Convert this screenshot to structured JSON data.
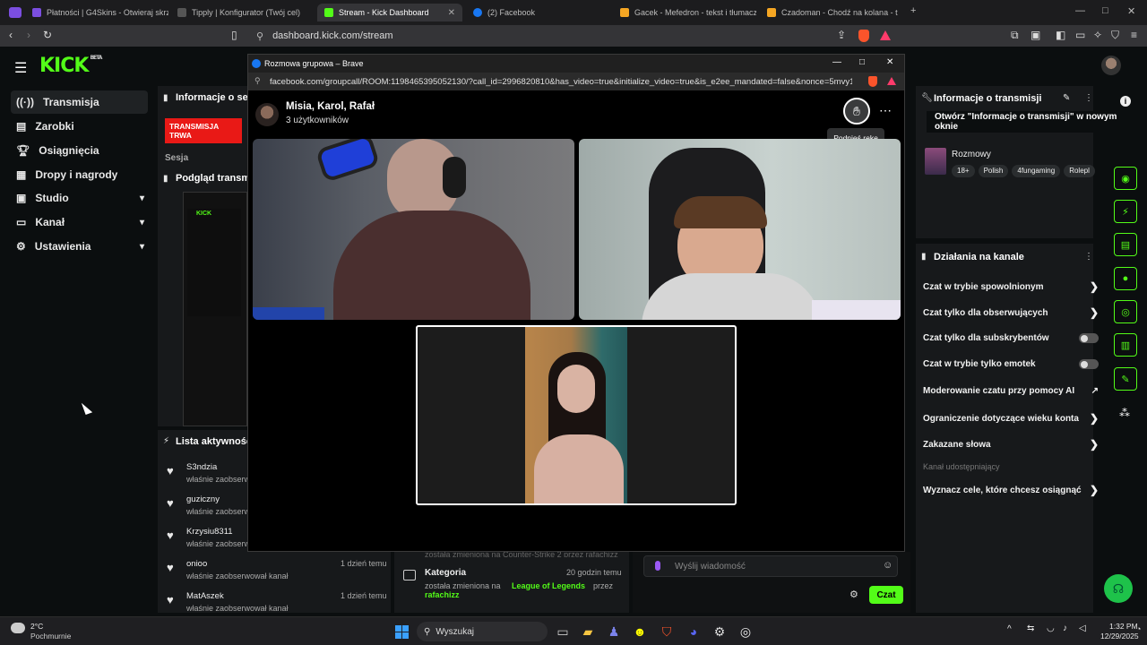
{
  "browser": {
    "tabs": [
      {
        "label": "Płatności | G4Skins - Otwieraj skrzyn",
        "color": "#7b4ee0"
      },
      {
        "label": "Tipply | Konfigurator (Twój cel)",
        "color": "#444"
      },
      {
        "label": "Stream - Kick Dashboard",
        "color": "#53fc18"
      },
      {
        "label": "(2) Facebook",
        "color": "#1877f2"
      },
      {
        "label": "Gacek - Mefedron - tekst i tłumaczen",
        "color": "#f5a623"
      },
      {
        "label": "Czadoman - Chodź na kolana - tekst",
        "color": "#f5a623"
      }
    ],
    "url": "dashboard.kick.com/stream"
  },
  "kick": {
    "logo": "KICK",
    "logo_badge": "BETA",
    "nav": [
      {
        "label": "Transmisja",
        "icon": "broadcast-icon"
      },
      {
        "label": "Zarobki",
        "icon": "money-icon"
      },
      {
        "label": "Osiągnięcia",
        "icon": "trophy-icon"
      },
      {
        "label": "Dropy i nagrody",
        "icon": "gift-icon"
      },
      {
        "label": "Studio",
        "icon": "studio-icon"
      },
      {
        "label": "Kanał",
        "icon": "channel-icon"
      },
      {
        "label": "Ustawienia",
        "icon": "gear-icon"
      }
    ],
    "session_info": {
      "title": "Informacje o sesji",
      "status": "TRANSMISJA TRWA",
      "session_label": "Sesja"
    },
    "preview": {
      "title": "Podgląd transmisji"
    },
    "activity": {
      "title": "Lista aktywności",
      "items": [
        {
          "user": "S3ndzia",
          "text": "właśnie zaobserwował kanał",
          "time": ""
        },
        {
          "user": "guziczny",
          "text": "właśnie zaobserwował kanał",
          "time": ""
        },
        {
          "user": "Krzysiu8311",
          "text": "właśnie zaobserwował kanał",
          "time": ""
        },
        {
          "user": "onioo",
          "text": "właśnie zaobserwował kanał",
          "time": "1 dzień temu"
        },
        {
          "user": "MatAszek",
          "text": "właśnie zaobserwował kanał",
          "time": "1 dzień temu"
        }
      ]
    },
    "history": {
      "partial": "została zmieniona na Counter-Strike 2 przez rafachizz",
      "title": "Kategoria",
      "time": "20 godzin temu",
      "text_prefix": "została zmieniona na",
      "game": "League of Legends",
      "by": "przez",
      "user": "rafachizz"
    },
    "chat": {
      "placeholder": "Wyślij wiadomość",
      "send": "Czat"
    },
    "stream_info": {
      "title": "Informacje o transmisji",
      "tooltip": "Otwórz \"Informacje o transmisji\" w nowym oknie",
      "category": "Rozmowy",
      "tags": [
        "18+",
        "Polish",
        "4fungaming",
        "Rolepl"
      ]
    },
    "channel_actions": {
      "title": "Działania na kanale",
      "items": [
        {
          "label": "Czat w trybie spowolnionym",
          "kind": "chevron"
        },
        {
          "label": "Czat tylko dla obserwujących",
          "kind": "chevron"
        },
        {
          "label": "Czat tylko dla subskrybentów",
          "kind": "toggle"
        },
        {
          "label": "Czat w trybie tylko emotek",
          "kind": "toggle"
        },
        {
          "label": "Moderowanie czatu przy pomocy AI",
          "kind": "external"
        },
        {
          "label": "Ograniczenie dotyczące wieku konta",
          "kind": "chevron"
        },
        {
          "label": "Zakazane słowa",
          "kind": "chevron"
        }
      ],
      "shared_label": "Kanał udostępniający",
      "goal": "Wyznacz cele, które chcesz osiągnąć"
    }
  },
  "fbcall": {
    "window_title": "Rozmowa grupowa – Brave",
    "url": "facebook.com/groupcall/ROOM:1198465395052130/?call_id=2996820810&has_video=true&initialize_video=true&is_e2ee_mandated=false&nonce=5mvy1...",
    "group_name": "Misia, Karol, Rafał",
    "members": "3 użytkowników",
    "raise_hand_tooltip": "Podnieś rękę"
  },
  "taskbar": {
    "weather_temp": "2°C",
    "weather_desc": "Pochmurnie",
    "search": "Wyszukaj",
    "time": "1:32 PM",
    "date": "12/29/2025"
  },
  "colors": {
    "accent": "#53fc18",
    "live": "#e91916"
  }
}
